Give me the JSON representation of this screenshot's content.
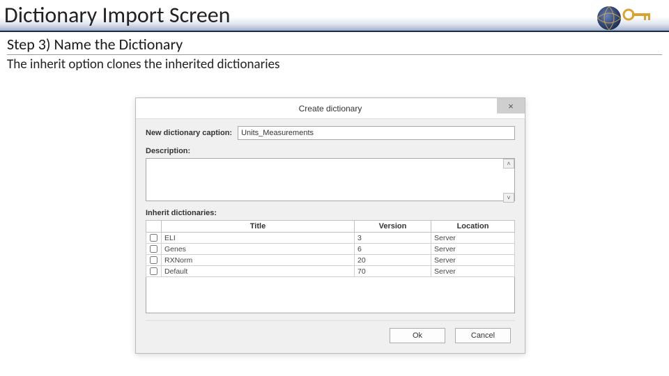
{
  "slide": {
    "title": "Dictionary Import Screen",
    "step": "Step 3) Name the Dictionary",
    "desc": "The inherit option clones the inherited dictionaries"
  },
  "dialog": {
    "title": "Create dictionary",
    "caption_label": "New dictionary caption:",
    "caption_value": "Units_Measurements",
    "description_label": "Description:",
    "description_value": "",
    "inherit_label": "Inherit dictionaries:",
    "columns": {
      "title": "Title",
      "version": "Version",
      "location": "Location"
    },
    "rows": [
      {
        "title": "ELI",
        "version": "3",
        "location": "Server"
      },
      {
        "title": "Genes",
        "version": "6",
        "location": "Server"
      },
      {
        "title": "RXNorm",
        "version": "20",
        "location": "Server"
      },
      {
        "title": "Default",
        "version": "70",
        "location": "Server"
      }
    ],
    "buttons": {
      "ok": "Ok",
      "cancel": "Cancel"
    }
  }
}
